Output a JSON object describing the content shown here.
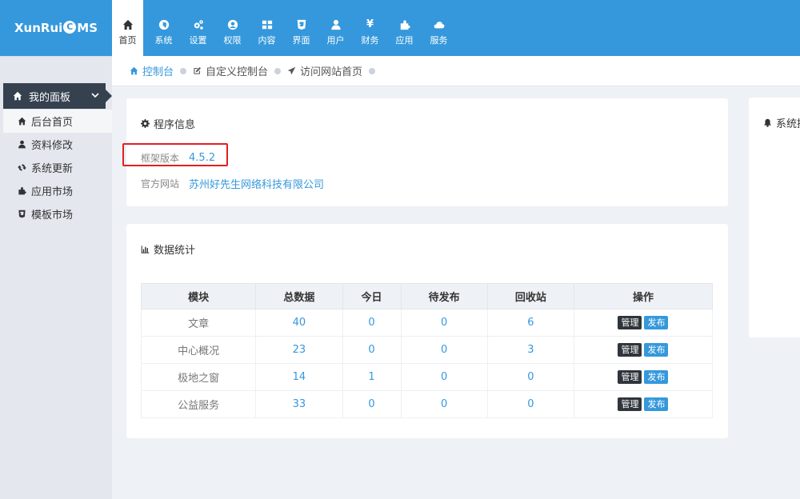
{
  "app": {
    "logo_left": "XunRui",
    "logo_mark": "C",
    "logo_right": "MS"
  },
  "nav": [
    {
      "label": "首页",
      "icon": "home-icon",
      "active": true
    },
    {
      "label": "系统",
      "icon": "globe-icon"
    },
    {
      "label": "设置",
      "icon": "cogs-icon"
    },
    {
      "label": "权限",
      "icon": "user-circle-icon"
    },
    {
      "label": "内容",
      "icon": "grid-icon"
    },
    {
      "label": "界面",
      "icon": "html5-icon"
    },
    {
      "label": "用户",
      "icon": "user-icon"
    },
    {
      "label": "财务",
      "icon": "yen-icon"
    },
    {
      "label": "应用",
      "icon": "puzzle-icon"
    },
    {
      "label": "服务",
      "icon": "cloud-icon"
    }
  ],
  "sidebar": {
    "head": "我的面板",
    "items": [
      {
        "label": "后台首页",
        "icon": "home-icon"
      },
      {
        "label": "资料修改",
        "icon": "user-icon"
      },
      {
        "label": "系统更新",
        "icon": "refresh-icon"
      },
      {
        "label": "应用市场",
        "icon": "puzzle-icon"
      },
      {
        "label": "模板市场",
        "icon": "html5-icon"
      }
    ]
  },
  "breadcrumb": [
    {
      "label": "控制台",
      "icon": "home-icon"
    },
    {
      "label": "自定义控制台",
      "icon": "edit-icon"
    },
    {
      "label": "访问网站首页",
      "icon": "send-icon"
    }
  ],
  "info": {
    "title": "程序信息",
    "version_label": "框架版本",
    "version_value": "4.5.2",
    "site_label": "官方网站",
    "site_value": "苏州好先生网络科技有限公司"
  },
  "stats": {
    "title": "数据统计",
    "headers": [
      "模块",
      "总数据",
      "今日",
      "待发布",
      "回收站",
      "操作"
    ],
    "rows": [
      {
        "name": "文章",
        "total": "40",
        "today": "0",
        "pending": "0",
        "recycle": "6"
      },
      {
        "name": "中心概况",
        "total": "23",
        "today": "0",
        "pending": "0",
        "recycle": "3"
      },
      {
        "name": "极地之窗",
        "total": "14",
        "today": "1",
        "pending": "0",
        "recycle": "0"
      },
      {
        "name": "公益服务",
        "total": "33",
        "today": "0",
        "pending": "0",
        "recycle": "0"
      }
    ],
    "manage_label": "管理",
    "publish_label": "发布"
  },
  "side_panel": {
    "title": "系统提"
  },
  "colors": {
    "primary": "#3598dc",
    "sidebar_head": "#364150",
    "highlight": "#e02020"
  }
}
